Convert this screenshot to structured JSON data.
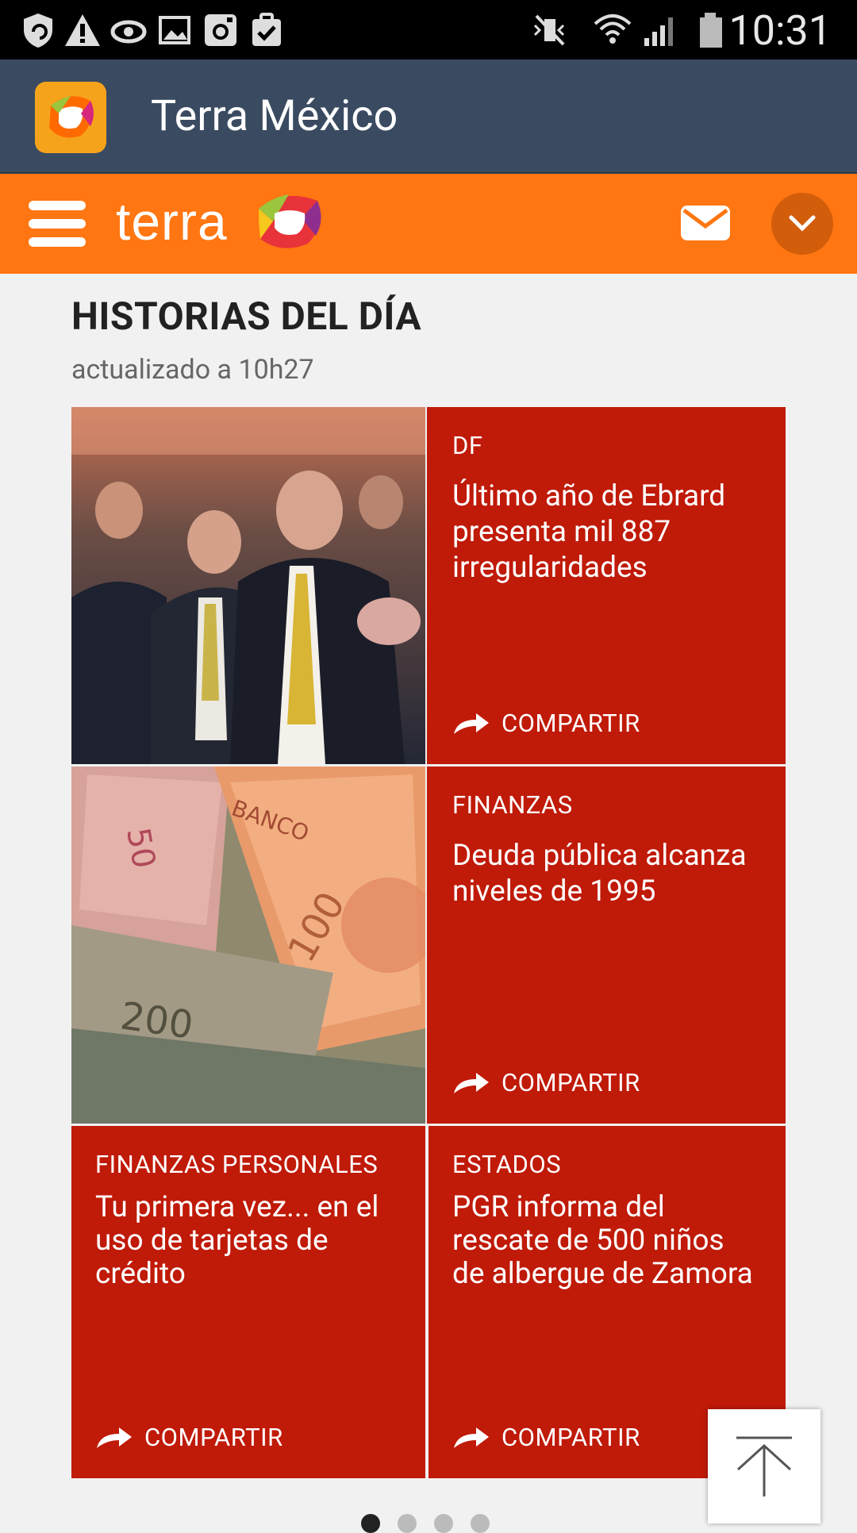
{
  "status_bar": {
    "icons": [
      "shield-sync-icon",
      "warning-icon",
      "sync-icon",
      "image-icon",
      "instagram-icon",
      "task-icon",
      "mute-icon",
      "wifi-icon",
      "signal-icon",
      "battery-icon"
    ],
    "time": "10:31"
  },
  "app_bar": {
    "title": "Terra México"
  },
  "terra_bar": {
    "brand": "terra",
    "colors": {
      "brand_orange": "#ff7612",
      "tile_red": "#c01a08",
      "app_bar": "#3a4b61"
    }
  },
  "section": {
    "title": "HISTORIAS DEL DÍA",
    "subtitle": "actualizado a 10h27"
  },
  "stories": [
    {
      "category": "DF",
      "headline": "Último año de Ebrard presenta mil 887 irregularidades",
      "share": "COMPARTIR"
    },
    {
      "category": "FINANZAS",
      "headline": "Deuda pública alcanza niveles de 1995",
      "share": "COMPARTIR"
    },
    {
      "category": "FINANZAS PERSONALES",
      "headline": "Tu primera vez... en el uso de tarjetas de crédito",
      "share": "COMPARTIR"
    },
    {
      "category": "ESTADOS",
      "headline": "PGR informa del rescate de 500 niños de albergue de Zamora",
      "share": "COMPARTIR"
    }
  ],
  "pager": {
    "pages": 4,
    "current": 1
  }
}
